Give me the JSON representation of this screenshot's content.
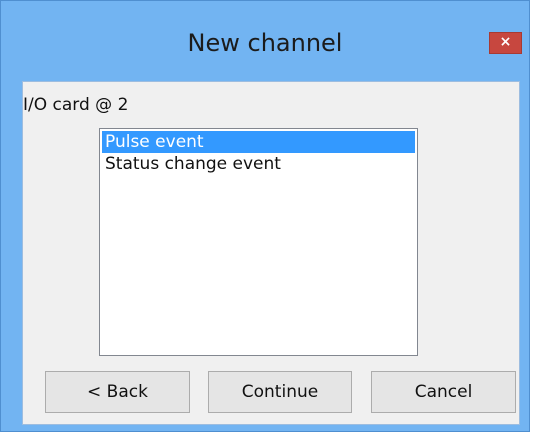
{
  "window": {
    "title": "New channel",
    "close_glyph": "×"
  },
  "dialog": {
    "card_label": "I/O card @ 2",
    "list_items": [
      "Pulse event",
      "Status change event"
    ],
    "selected_index": 0
  },
  "buttons": {
    "back": "< Back",
    "continue": "Continue",
    "cancel": "Cancel"
  },
  "colors": {
    "frame": "#72b4f2",
    "close_button": "#c7473f",
    "selection": "#3399ff",
    "client_bg": "#f0f0f0"
  }
}
